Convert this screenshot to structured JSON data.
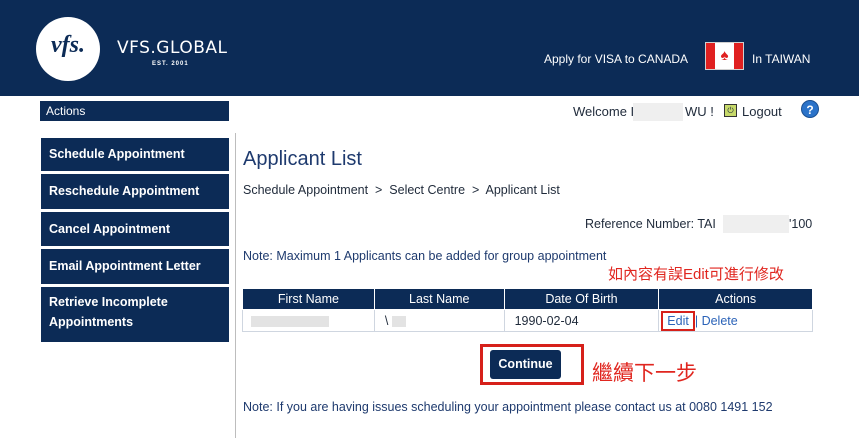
{
  "header": {
    "logo_text": "vfs.",
    "brand": "VFS.GLOBAL",
    "est": "EST. 2001",
    "apply_text": "Apply for VISA to CANADA",
    "country_text": "In TAIWAN"
  },
  "sidebar": {
    "heading": "Actions",
    "items": [
      {
        "label": "Schedule Appointment"
      },
      {
        "label": "Reschedule Appointment"
      },
      {
        "label": "Cancel Appointment"
      },
      {
        "label": "Email Appointment Letter"
      },
      {
        "label": "Retrieve Incomplete Appointments"
      }
    ]
  },
  "topbar": {
    "welcome_prefix": "Welcome I",
    "welcome_suffix": "WU !",
    "logout": "Logout",
    "help": "?"
  },
  "main": {
    "title": "Applicant List",
    "breadcrumb": "Schedule Appointment  >  Select Centre  >  Applicant List",
    "reference_prefix": "Reference Number: TAI",
    "reference_suffix": "'100",
    "note_max": "Note: Maximum 1 Applicants can be added for group appointment",
    "annotation_edit": "如內容有誤Edit可進行修改",
    "table": {
      "headers": [
        "First Name",
        "Last Name",
        "Date Of Birth",
        "Actions"
      ],
      "rows": [
        {
          "first_name": "",
          "last_name": "\\",
          "dob": "1990-02-04",
          "edit": "Edit",
          "delete": "Delete",
          "separator": "|"
        }
      ]
    },
    "continue_label": "Continue",
    "annotation_continue": "繼續下一步",
    "note_issues": "Note: If you are having issues scheduling your appointment please contact us at 0080 1491 152"
  },
  "colors": {
    "navy": "#0c2b56",
    "annotation_red": "#e0261f",
    "link_blue": "#2b63b8"
  }
}
